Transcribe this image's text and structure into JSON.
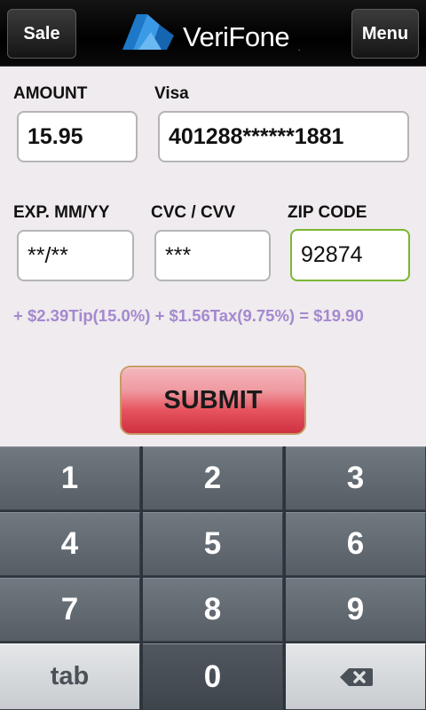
{
  "header": {
    "left_button": "Sale",
    "right_button": "Menu",
    "logo_text": "VeriFone",
    "logo_mark": "."
  },
  "form": {
    "amount_label": "AMOUNT",
    "amount_value": "15.95",
    "card_label": "Visa",
    "card_value": "401288******1881",
    "exp_label": "EXP. MM/YY",
    "exp_value": "**/**",
    "cvc_label": "CVC / CVV",
    "cvc_value": "***",
    "zip_label": "ZIP CODE",
    "zip_value": "92874",
    "summary": "+ $2.39Tip(15.0%) + $1.56Tax(9.75%) = $19.90",
    "submit_label": "SUBMIT"
  },
  "keypad": {
    "keys": [
      "1",
      "2",
      "3",
      "4",
      "5",
      "6",
      "7",
      "8",
      "9",
      "tab",
      "0",
      "backspace-icon"
    ]
  },
  "colors": {
    "summary_text": "#a489cf",
    "focus_border": "#7bb733",
    "submit_red": "#e6545f"
  }
}
